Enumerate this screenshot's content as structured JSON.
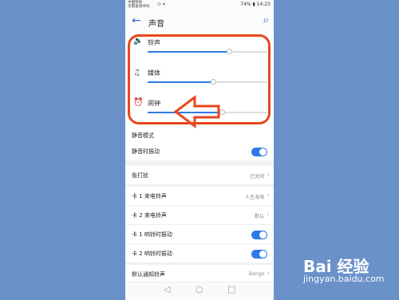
{
  "statusbar": {
    "carrier_line1": "中国移动",
    "carrier_line2": "仅限紧急呼叫",
    "icons": "⊙ ▾",
    "right": "74% ▮ 14:23"
  },
  "appbar": {
    "back_icon": "back-arrow-icon",
    "title": "声音",
    "search_icon": "search-icon"
  },
  "volume": [
    {
      "label": "铃声",
      "icon": "speaker-icon",
      "level": 0.68
    },
    {
      "label": "媒体",
      "icon": "music-note-icon",
      "level": 0.55
    },
    {
      "label": "闹钟",
      "icon": "alarm-clock-icon",
      "level": 0.62
    }
  ],
  "settings": [
    {
      "label": "静音模式",
      "type": "toggle",
      "on": false
    },
    {
      "label": "静音时振动",
      "type": "toggle",
      "on": true
    },
    {
      "label": "免打扰",
      "type": "link",
      "value": "已关闭"
    },
    {
      "label": "卡 1 来电铃声",
      "type": "link",
      "value": "人生海海"
    },
    {
      "label": "卡 2 来电铃声",
      "type": "link",
      "value": "默认"
    },
    {
      "label": "卡 1 响铃时振动",
      "type": "toggle",
      "on": true
    },
    {
      "label": "卡 2 响铃时振动",
      "type": "toggle",
      "on": true
    },
    {
      "label": "默认通知铃声",
      "type": "link",
      "value": "Bongo"
    }
  ],
  "navbar": {
    "back": "◁",
    "home": "○",
    "recent": "□"
  },
  "annotation_color": "#e8471d",
  "watermark": {
    "brand": "Bai 经验",
    "url": "jingyan.baidu.com"
  }
}
